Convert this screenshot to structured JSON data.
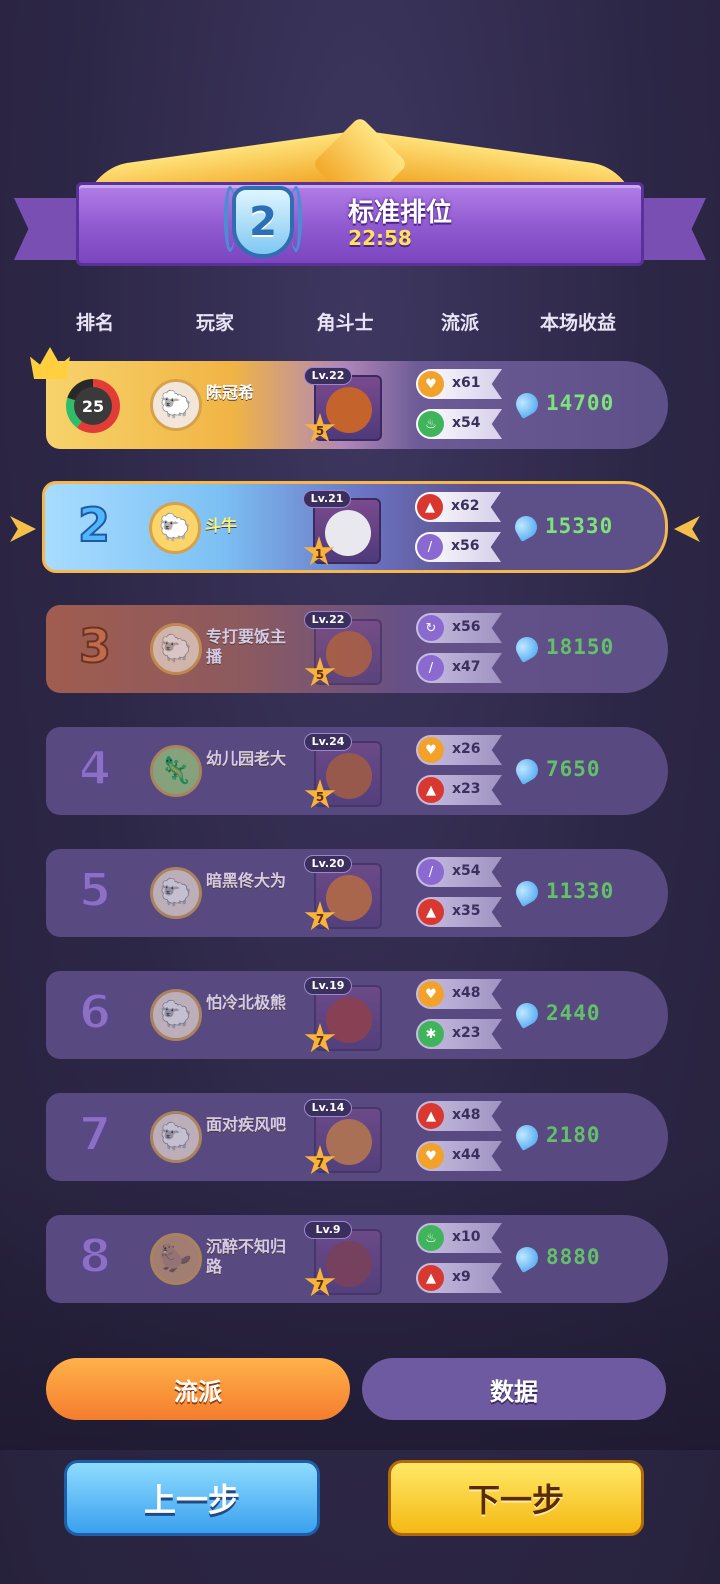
{
  "banner": {
    "rank": "2",
    "title": "标准排位",
    "time": "22:58"
  },
  "columns": [
    "排名",
    "玩家",
    "角斗士",
    "流派",
    "本场收益"
  ],
  "rows": [
    {
      "rank": "1",
      "player_level": "25",
      "name": "陈冠希",
      "fighter_level": "Lv.22",
      "stars": "5",
      "genre1": {
        "icon": "heart-icon",
        "color": "#f2a12b",
        "count": "x61"
      },
      "genre2": {
        "icon": "potion-icon",
        "color": "#3fb45a",
        "count": "x54"
      },
      "earnings": "14700"
    },
    {
      "rank": "2",
      "name": "斗牛",
      "fighter_level": "Lv.21",
      "stars": "1",
      "genre1": {
        "icon": "flame-icon",
        "color": "#d8382f",
        "count": "x62"
      },
      "genre2": {
        "icon": "sword-icon",
        "color": "#8a6ad0",
        "count": "x56"
      },
      "earnings": "15330"
    },
    {
      "rank": "3",
      "name": "专打要饭主播",
      "fighter_level": "Lv.22",
      "stars": "5",
      "genre1": {
        "icon": "cycle-icon",
        "color": "#8a6ad0",
        "count": "x56"
      },
      "genre2": {
        "icon": "sword-icon",
        "color": "#8a6ad0",
        "count": "x47"
      },
      "earnings": "18150"
    },
    {
      "rank": "4",
      "name": "幼儿园老大",
      "fighter_level": "Lv.24",
      "stars": "5",
      "genre1": {
        "icon": "heart-icon",
        "color": "#f2a12b",
        "count": "x26"
      },
      "genre2": {
        "icon": "flame-icon",
        "color": "#d8382f",
        "count": "x23"
      },
      "earnings": "7650"
    },
    {
      "rank": "5",
      "name": "暗黑佟大为",
      "fighter_level": "Lv.20",
      "stars": "7",
      "genre1": {
        "icon": "sword-icon",
        "color": "#8a6ad0",
        "count": "x54"
      },
      "genre2": {
        "icon": "flame-icon",
        "color": "#d8382f",
        "count": "x35"
      },
      "earnings": "11330"
    },
    {
      "rank": "6",
      "name": "怕冷北极熊",
      "fighter_level": "Lv.19",
      "stars": "7",
      "genre1": {
        "icon": "heart-icon",
        "color": "#f2a12b",
        "count": "x48"
      },
      "genre2": {
        "icon": "snowflake-icon",
        "color": "#3fb45a",
        "count": "x23"
      },
      "earnings": "2440"
    },
    {
      "rank": "7",
      "name": "面对疾风吧",
      "fighter_level": "Lv.14",
      "stars": "7",
      "genre1": {
        "icon": "flame-icon",
        "color": "#d8382f",
        "count": "x48"
      },
      "genre2": {
        "icon": "heart-icon",
        "color": "#f2a12b",
        "count": "x44"
      },
      "earnings": "2180"
    },
    {
      "rank": "8",
      "name": "沉醉不知归路",
      "fighter_level": "Lv.9",
      "stars": "7",
      "genre1": {
        "icon": "potion-icon",
        "color": "#3fb45a",
        "count": "x10"
      },
      "genre2": {
        "icon": "flame-icon",
        "color": "#d8382f",
        "count": "x9"
      },
      "earnings": "8880"
    }
  ],
  "tabs": {
    "genre": "流派",
    "data": "数据"
  },
  "buttons": {
    "prev": "上一步",
    "next": "下一步"
  }
}
